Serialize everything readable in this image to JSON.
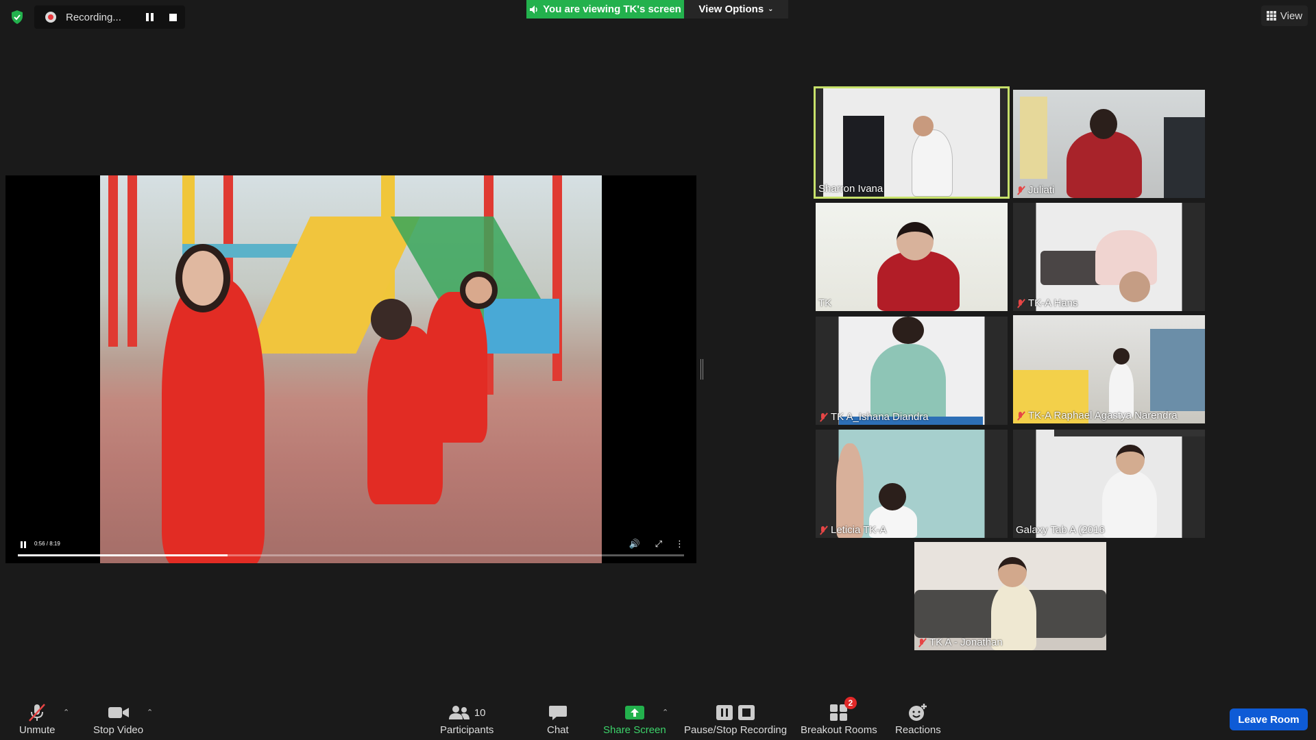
{
  "top": {
    "recording_label": "Recording...",
    "viewing_banner": "You are viewing TK's screen",
    "view_options_label": "View Options",
    "view_label": "View"
  },
  "shared_video": {
    "time": "0:56 / 8:19",
    "progress_fraction": 0.315
  },
  "participants": [
    {
      "name": "Sharron Ivana",
      "muted": false,
      "active": true
    },
    {
      "name": "Juliati",
      "muted": true,
      "active": false
    },
    {
      "name": "TK",
      "muted": false,
      "active": false
    },
    {
      "name": "TK-A Hans",
      "muted": true,
      "active": false
    },
    {
      "name": "TK A_Ishana Diandra",
      "muted": true,
      "active": false
    },
    {
      "name": "TK-A Raphael Agastya Narendra",
      "muted": true,
      "active": false
    },
    {
      "name": "Leticia TK-A",
      "muted": true,
      "active": false
    },
    {
      "name": "Galaxy Tab A (2016",
      "muted": false,
      "active": false
    },
    {
      "name": "TK A - Jonathan",
      "muted": true,
      "active": false
    }
  ],
  "toolbar": {
    "unmute": "Unmute",
    "stop_video": "Stop Video",
    "participants": "Participants",
    "participants_count": "10",
    "chat": "Chat",
    "share_screen": "Share Screen",
    "pause_stop_recording": "Pause/Stop Recording",
    "breakout_rooms": "Breakout Rooms",
    "breakout_badge": "2",
    "reactions": "Reactions",
    "leave_room": "Leave Room"
  },
  "colors": {
    "banner_green": "#23b14d",
    "active_speaker": "#c7e16a",
    "leave_blue": "#0e5bd6",
    "mute_red": "#e64545"
  }
}
